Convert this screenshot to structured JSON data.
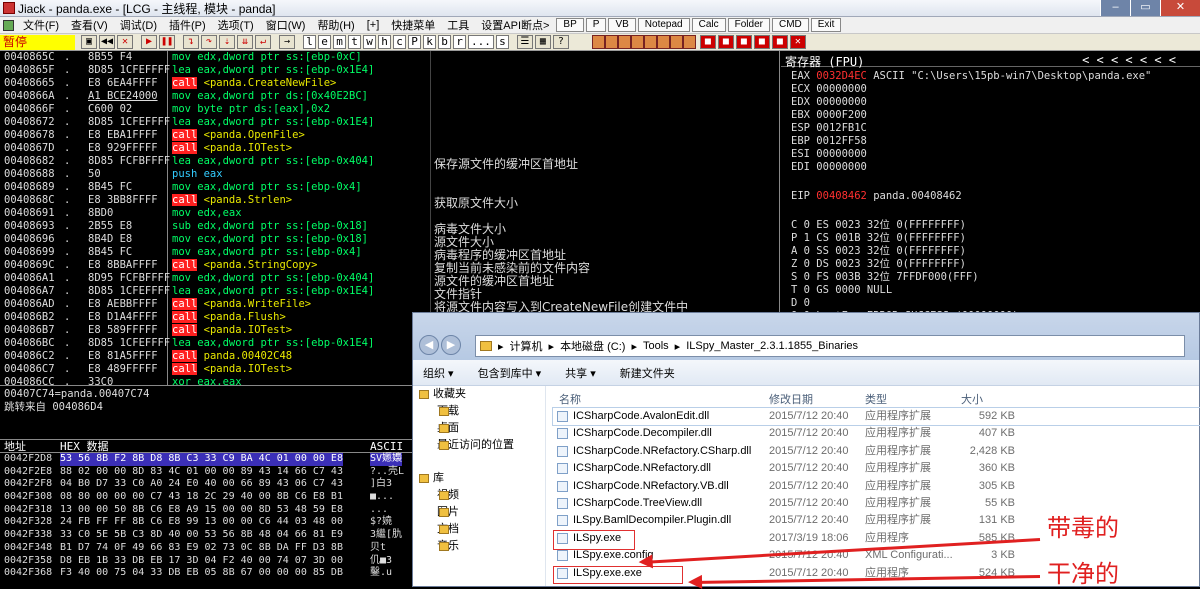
{
  "window": {
    "title": "Jiack - panda.exe - [LCG - 主线程, 模块 - panda]"
  },
  "menu": [
    "文件(F)",
    "查看(V)",
    "调试(D)",
    "插件(P)",
    "选项(T)",
    "窗口(W)",
    "帮助(H)",
    "[+]",
    "快捷菜单",
    "工具",
    "设置API断点>"
  ],
  "menu_buttons": [
    "BP",
    "P",
    "VB",
    "Notepad",
    "Calc",
    "Folder",
    "CMD",
    "Exit"
  ],
  "toolbar": {
    "status": "暂停",
    "letters": [
      "l",
      "e",
      "m",
      "t",
      "w",
      "h",
      "c",
      "P",
      "k",
      "b",
      "r",
      "...",
      "s"
    ]
  },
  "disasm": [
    {
      "addr": "0040865C",
      "mark": ".",
      "hex": "8B55 F4",
      "ins": "mov edx,dword ptr ss:[ebp-0xC]",
      "cls": "g",
      "comment": ""
    },
    {
      "addr": "0040865F",
      "mark": ".",
      "hex": "8D85 1CFEFFFF",
      "ins": "lea eax,dword ptr ss:[ebp-0x1E4]",
      "cls": "g",
      "comment": ""
    },
    {
      "addr": "00408665",
      "mark": ".",
      "hex": "E8 6EA4FFFF",
      "ins": "call <panda.CreateNewFile>",
      "cls": "call",
      "comment": ""
    },
    {
      "addr": "0040866A",
      "mark": ".",
      "hex": "A1 BCE24000",
      "ins": "mov eax,dword ptr ds:[0x40E2BC]",
      "cls": "g",
      "comment": ""
    },
    {
      "addr": "0040866F",
      "mark": ".",
      "hex": "C600 02",
      "ins": "mov byte ptr ds:[eax],0x2",
      "cls": "g",
      "comment": ""
    },
    {
      "addr": "00408672",
      "mark": ".",
      "hex": "8D85 1CFEFFFF",
      "ins": "lea eax,dword ptr ss:[ebp-0x1E4]",
      "cls": "g",
      "comment": ""
    },
    {
      "addr": "00408678",
      "mark": ".",
      "hex": "E8 EBA1FFFF",
      "ins": "call <panda.OpenFile>",
      "cls": "call",
      "comment": ""
    },
    {
      "addr": "0040867D",
      "mark": ".",
      "hex": "E8 929FFFFF",
      "ins": "call <panda.IOTest>",
      "cls": "call",
      "comment": ""
    },
    {
      "addr": "00408682",
      "mark": ".",
      "hex": "8D85 FCFBFFFF",
      "ins": "lea eax,dword ptr ss:[ebp-0x404]",
      "cls": "g",
      "comment": "保存源文件的缓冲区首地址"
    },
    {
      "addr": "00408688",
      "mark": ".",
      "hex": "50",
      "ins": "push eax",
      "cls": "pu",
      "comment": ""
    },
    {
      "addr": "00408689",
      "mark": ".",
      "hex": "8B45 FC",
      "ins": "mov eax,dword ptr ss:[ebp-0x4]",
      "cls": "g",
      "comment": ""
    },
    {
      "addr": "0040868C",
      "mark": ".",
      "hex": "E8 3BB8FFFF",
      "ins": "call <panda.Strlen>",
      "cls": "call",
      "comment": "获取原文件大小"
    },
    {
      "addr": "00408691",
      "mark": ".",
      "hex": "8BD0",
      "ins": "mov edx,eax",
      "cls": "g",
      "comment": ""
    },
    {
      "addr": "00408693",
      "mark": ".",
      "hex": "2B55 E8",
      "ins": "sub edx,dword ptr ss:[ebp-0x18]",
      "cls": "g",
      "comment": "病毒文件大小"
    },
    {
      "addr": "00408696",
      "mark": ".",
      "hex": "8B4D E8",
      "ins": "mov ecx,dword ptr ss:[ebp-0x18]",
      "cls": "g",
      "comment": "源文件大小"
    },
    {
      "addr": "00408699",
      "mark": ".",
      "hex": "8B45 FC",
      "ins": "mov eax,dword ptr ss:[ebp-0x4]",
      "cls": "g",
      "comment": "病毒程序的缓冲区首地址"
    },
    {
      "addr": "0040869C",
      "mark": ".",
      "hex": "E8 8BBAFFFF",
      "ins": "call <panda.StringCopy>",
      "cls": "call",
      "comment": "复制当前未感染前的文件内容"
    },
    {
      "addr": "004086A1",
      "mark": ".",
      "hex": "8D95 FCFBFFFF",
      "ins": "mov edx,dword ptr ss:[ebp-0x404]",
      "cls": "g",
      "comment": "源文件的缓冲区首地址"
    },
    {
      "addr": "004086A7",
      "mark": ".",
      "hex": "8D85 1CFEFFFF",
      "ins": "lea eax,dword ptr ss:[ebp-0x1E4]",
      "cls": "g",
      "comment": "文件指针"
    },
    {
      "addr": "004086AD",
      "mark": ".",
      "hex": "E8 AEBBFFFF",
      "ins": "call <panda.WriteFile>",
      "cls": "call",
      "comment": "将源文件内容写入到CreateNewFile创建文件中"
    },
    {
      "addr": "004086B2",
      "mark": ".",
      "hex": "E8 D1A4FFFF",
      "ins": "call <panda.Flush>",
      "cls": "call",
      "comment": ""
    },
    {
      "addr": "004086B7",
      "mark": ".",
      "hex": "E8 589FFFFF",
      "ins": "call <panda.IOTest>",
      "cls": "call",
      "comment": ""
    },
    {
      "addr": "004086BC",
      "mark": ".",
      "hex": "8D85 1CFEFFFF",
      "ins": "lea eax,dword ptr ss:[ebp-0x1E4]",
      "cls": "g",
      "comment": ""
    },
    {
      "addr": "004086C2",
      "mark": ".",
      "hex": "E8 81A5FFFF",
      "ins": "call panda.00402C48",
      "cls": "call",
      "comment": ""
    },
    {
      "addr": "004086C7",
      "mark": ".",
      "hex": "E8 489FFFFF",
      "ins": "call <panda.IOTest>",
      "cls": "call",
      "comment": ""
    },
    {
      "addr": "004086CC",
      "mark": ".",
      "hex": "33C0",
      "ins": "xor eax,eax",
      "cls": "g",
      "comment": ""
    }
  ],
  "info": [
    "00407C74=panda.00407C74",
    "跳转来自 004086D4"
  ],
  "registers": {
    "title": "寄存器 (FPU)",
    "nav": "<   <   <   <   <   <   <",
    "lines": [
      {
        "n": "EAX",
        "v": "0032D4EC",
        "red": true,
        "rest": "ASCII \"C:\\Users\\15pb-win7\\Desktop\\panda.exe\""
      },
      {
        "n": "ECX",
        "v": "00000000",
        "red": false,
        "rest": ""
      },
      {
        "n": "EDX",
        "v": "00000000",
        "red": false,
        "rest": ""
      },
      {
        "n": "EBX",
        "v": "0000F200",
        "red": false,
        "rest": ""
      },
      {
        "n": "ESP",
        "v": "0012FB1C",
        "red": false,
        "rest": ""
      },
      {
        "n": "EBP",
        "v": "0012FF58",
        "red": false,
        "rest": ""
      },
      {
        "n": "ESI",
        "v": "00000000",
        "red": false,
        "rest": ""
      },
      {
        "n": "EDI",
        "v": "00000000",
        "red": false,
        "rest": ""
      },
      {
        "n": "",
        "v": "",
        "red": false,
        "rest": ""
      },
      {
        "n": "EIP",
        "v": "00408462",
        "red": true,
        "rest": "panda.00408462"
      },
      {
        "n": "",
        "v": "",
        "red": false,
        "rest": ""
      },
      {
        "n": "C 0",
        "v": "ES 0023",
        "red": false,
        "rest": "32位 0(FFFFFFFF)"
      },
      {
        "n": "P 1",
        "v": "CS 001B",
        "red": false,
        "rest": "32位 0(FFFFFFFF)"
      },
      {
        "n": "A 0",
        "v": "SS 0023",
        "red": false,
        "rest": "32位 0(FFFFFFFF)"
      },
      {
        "n": "Z 0",
        "v": "DS 0023",
        "red": false,
        "rest": "32位 0(FFFFFFFF)"
      },
      {
        "n": "S 0",
        "v": "FS 003B",
        "red": false,
        "rest": "32位 7FFDF000(FFF)"
      },
      {
        "n": "T 0",
        "v": "GS 0000",
        "red": false,
        "rest": "NULL"
      },
      {
        "n": "D 0",
        "v": "",
        "red": false,
        "rest": ""
      },
      {
        "n": "O 0",
        "v": "LastErr",
        "red": false,
        "rest": "ERROR_SUCCESS (00000000)"
      }
    ]
  },
  "dump": {
    "headers": {
      "addr": "地址",
      "hex": "HEX 数据",
      "ascii": "ASCII"
    },
    "rows": [
      {
        "addr": "0042F2D8",
        "hex": "53 56 8B F2 8B D8 8B C3 33 C9 BA 4C 01 00 00 E8",
        "ascii": "SV嬺嬝"
      },
      {
        "addr": "0042F2E8",
        "hex": "88 02 00 00 8D 83 4C 01 00 00 89 43 14 66 C7 43",
        "ascii": "?..壳L"
      },
      {
        "addr": "0042F2F8",
        "hex": "04 B0 D7 33 C0 A0 24 E0 40 00 66 89 43 06 C7 43",
        "ascii": "]白3"
      },
      {
        "addr": "0042F308",
        "hex": "08 80 00 00 00 C7 43 18 2C 29 40 00 8B C6 E8 B1",
        "ascii": "■..."
      },
      {
        "addr": "0042F318",
        "hex": "13 00 00 50 8B C6 E8 A9 15 00 00 8D 53 48 59 E8",
        "ascii": "..."
      },
      {
        "addr": "0042F328",
        "hex": "24 FB FF FF 8B C6 E8 99 13 00 00 C6 44 03 48 00",
        "ascii": "$?嬈"
      },
      {
        "addr": "0042F338",
        "hex": "33 C0 5E 5B C3 8D 40 00 53 56 8B 48 04 66 81 E9",
        "ascii": "3繼[肍"
      },
      {
        "addr": "0042F348",
        "hex": "B1 D7 74 0F 49 66 83 E9 02 73 0C 8B DA FF D3 8B",
        "ascii": "贝t"
      },
      {
        "addr": "0042F358",
        "hex": "D8 EB 1B 33 DB EB 17 3D 04 F2 40 00 74 07 3D 00",
        "ascii": "仉■3"
      },
      {
        "addr": "0042F368",
        "hex": "F3 40 00 75 04 33 DB EB 05 8B 67 00 00 00 85 DB",
        "ascii": "鑿.u"
      }
    ]
  },
  "explorer": {
    "path": [
      "计算机",
      "本地磁盘 (C:)",
      "Tools",
      "ILSpy_Master_2.3.1.1855_Binaries"
    ],
    "commands": [
      "组织 ▾",
      "包含到库中 ▾",
      "共享 ▾",
      "新建文件夹"
    ],
    "sidebar": [
      {
        "label": "收藏夹",
        "sub": false
      },
      {
        "label": "下载",
        "sub": true
      },
      {
        "label": "桌面",
        "sub": true
      },
      {
        "label": "最近访问的位置",
        "sub": true
      },
      {
        "label": "",
        "sub": false
      },
      {
        "label": "库",
        "sub": false
      },
      {
        "label": "视频",
        "sub": true
      },
      {
        "label": "图片",
        "sub": true
      },
      {
        "label": "文档",
        "sub": true
      },
      {
        "label": "音乐",
        "sub": true
      }
    ],
    "columns": {
      "name": "名称",
      "date": "修改日期",
      "type": "类型",
      "size": "大小"
    },
    "files": [
      {
        "name": "ICSharpCode.AvalonEdit.dll",
        "date": "2015/7/12 20:40",
        "type": "应用程序扩展",
        "size": "592 KB"
      },
      {
        "name": "ICSharpCode.Decompiler.dll",
        "date": "2015/7/12 20:40",
        "type": "应用程序扩展",
        "size": "407 KB"
      },
      {
        "name": "ICSharpCode.NRefactory.CSharp.dll",
        "date": "2015/7/12 20:40",
        "type": "应用程序扩展",
        "size": "2,428 KB"
      },
      {
        "name": "ICSharpCode.NRefactory.dll",
        "date": "2015/7/12 20:40",
        "type": "应用程序扩展",
        "size": "360 KB"
      },
      {
        "name": "ICSharpCode.NRefactory.VB.dll",
        "date": "2015/7/12 20:40",
        "type": "应用程序扩展",
        "size": "305 KB"
      },
      {
        "name": "ICSharpCode.TreeView.dll",
        "date": "2015/7/12 20:40",
        "type": "应用程序扩展",
        "size": "55 KB"
      },
      {
        "name": "ILSpy.BamlDecompiler.Plugin.dll",
        "date": "2015/7/12 20:40",
        "type": "应用程序扩展",
        "size": "131 KB"
      },
      {
        "name": "ILSpy.exe",
        "date": "2017/3/19 18:06",
        "type": "应用程序",
        "size": "585 KB"
      },
      {
        "name": "ILSpy.exe.config",
        "date": "2015/7/12 20:40",
        "type": "XML Configurati...",
        "size": "3 KB"
      },
      {
        "name": "ILSpy.exe.exe",
        "date": "2015/7/12 20:40",
        "type": "应用程序",
        "size": "524 KB"
      }
    ]
  },
  "annotations": {
    "infected": "带毒的",
    "clean": "干净的"
  },
  "colors": {
    "annotation": "#e02020",
    "call_bg": "#ff2020",
    "selected_dump": "#3b2fb7"
  }
}
